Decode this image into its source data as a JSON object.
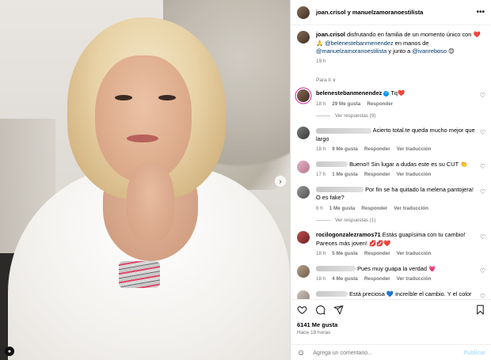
{
  "header": {
    "names": "joan.crisol y manuelzamoranoestilista",
    "more": "•••"
  },
  "caption": {
    "user": "joan.crisol",
    "text_1": " disfrutando en familia de un momento único con ",
    "emojis_1": "❤️ 🙏",
    "mention_1": "@belenestebanmenendez",
    "text_2": " en manos de ",
    "mention_2": "@manuelzamoranoestilista",
    "text_3": " y junto a ",
    "mention_3": "@ivanreboso",
    "emoji_end": "😊",
    "time": "19 h",
    "translate": "Para ti ∨"
  },
  "comments": [
    {
      "user": "belenestebanmenendez",
      "verified": true,
      "text": "Tq❤️",
      "time": "18 h",
      "likes": "29 Me gusta",
      "reply": "Responder",
      "translate": "",
      "replies": "Ver respuestas (9)"
    },
    {
      "user": "",
      "text": "Acierto total.te queda mucho mejor que largo",
      "time": "18 h",
      "likes": "9 Me gusta",
      "reply": "Responder",
      "translate": "Ver traducción",
      "replies": ""
    },
    {
      "user": "",
      "text": "Bueno!! Sin lugar a dudas este es su CUT 👏",
      "time": "17 h",
      "likes": "1 Me gusta",
      "reply": "Responder",
      "translate": "Ver traducción",
      "replies": ""
    },
    {
      "user": "",
      "text": "Por fin se ha quitado la melena pantojera! O es fake?",
      "time": "6 h",
      "likes": "1 Me gusta",
      "reply": "Responder",
      "translate": "Ver traducción",
      "replies": "Ver respuestas (1)"
    },
    {
      "user": "rocilogonzalezramos71",
      "text": "Estás guapísima con tu cambio! Pareces más joven! 💋💋❤️",
      "time": "18 h",
      "likes": "5 Me gusta",
      "reply": "Responder",
      "translate": "Ver traducción",
      "replies": ""
    },
    {
      "user": "",
      "text": "Pues muy guapa la verdad 💗",
      "time": "18 h",
      "likes": "4 Me gusta",
      "reply": "Responder",
      "translate": "Ver traducción",
      "replies": ""
    },
    {
      "user": "",
      "text": "Está preciosa 💙 increíble el cambio. Y el color es",
      "time": "",
      "likes": "",
      "reply": "",
      "translate": "",
      "replies": ""
    }
  ],
  "footer": {
    "likes": "6141 Me gusta",
    "ago": "Hace 19 horas",
    "comment_placeholder": "Agrega un comentario...",
    "publish": "Publicar"
  }
}
